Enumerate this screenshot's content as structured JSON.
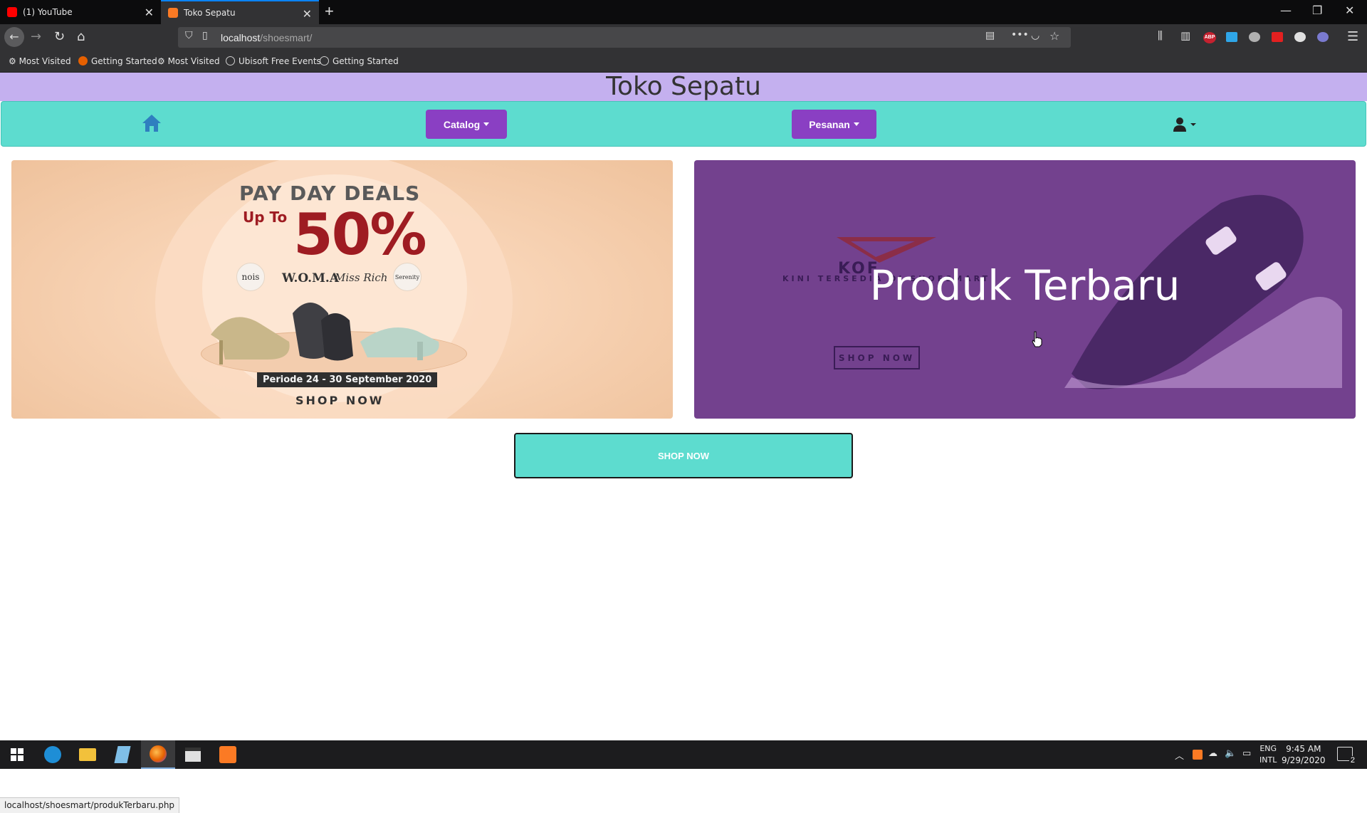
{
  "browser": {
    "tabs": [
      {
        "label": "(1) YouTube",
        "favicon_color": "#ff0000"
      },
      {
        "label": "Toko Sepatu",
        "favicon_color": "#fb7a24"
      }
    ],
    "new_tab_symbol": "+",
    "url": {
      "host": "localhost",
      "path": "/shoesmart/"
    },
    "bookmarks": [
      "Most Visited",
      "Getting Started",
      "Most Visited",
      "Ubisoft Free Events",
      "Getting Started"
    ],
    "status_url": "localhost/shoesmart/produkTerbaru.php",
    "extensions": {
      "abp": "ABP"
    }
  },
  "site": {
    "title": "Toko Sepatu",
    "nav": {
      "catalog_label": "Catalog",
      "pesanan_label": "Pesanan"
    },
    "colors": {
      "header": "#c4b0ef",
      "nav": "#5ddccf",
      "button": "#8a3fc3",
      "banner_right": "#73418e"
    }
  },
  "banner_left": {
    "headline": "PAY DAY DEALS",
    "upto": "Up To",
    "percent": "50%",
    "brands": [
      "nois",
      "W.O.M.A",
      "Miss Rich",
      "Serenity"
    ],
    "period": "Periode 24 - 30 September 2020",
    "cta": "SHOP NOW"
  },
  "banner_right": {
    "logo_text": "KOF",
    "tagline": "KINI TERSEDIA DI SHOESMART",
    "cta": "SHOP NOW",
    "title": "Produk Terbaru"
  },
  "main_cta": "SHOP NOW",
  "taskbar": {
    "lang": [
      "ENG",
      "INTL"
    ],
    "time": "9:45 AM",
    "date": "9/29/2020",
    "notifications": "2"
  }
}
